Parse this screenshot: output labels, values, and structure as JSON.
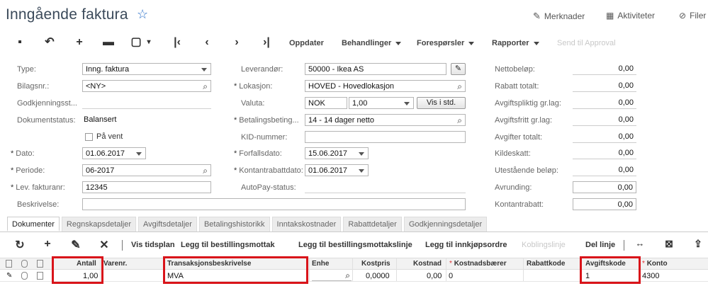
{
  "header": {
    "title": "Inngående faktura",
    "links": {
      "notes": "Merknader",
      "activities": "Aktiviteter",
      "files": "Filer"
    }
  },
  "toolbar": {
    "menus": {
      "refresh": "Oppdater",
      "actions": "Behandlinger",
      "inquiries": "Forespørsler",
      "reports": "Rapporter",
      "send_approval": "Send til Approval"
    }
  },
  "form": {
    "type": {
      "label": "Type:",
      "value": "Inng. faktura"
    },
    "ref_nbr": {
      "label": "Bilagsnr.:",
      "value": "<NY>"
    },
    "approval_status": {
      "label": "Godkjenningsst...",
      "value": ""
    },
    "doc_status": {
      "label": "Dokumentstatus:",
      "value": "Balansert"
    },
    "on_hold": {
      "label": "På vent"
    },
    "date": {
      "label": "Dato:",
      "value": "01.06.2017"
    },
    "period": {
      "label": "Periode:",
      "value": "06-2017"
    },
    "vendor_ref": {
      "label": "Lev. fakturanr:",
      "value": "12345"
    },
    "description": {
      "label": "Beskrivelse:",
      "value": ""
    },
    "vendor": {
      "label": "Leverandør:",
      "value": "50000 - Ikea AS"
    },
    "location": {
      "label": "Lokasjon:",
      "value": "HOVED - Hovedlokasjon"
    },
    "currency": {
      "label": "Valuta:",
      "code": "NOK",
      "rate": "1,00",
      "button": "Vis i std."
    },
    "terms": {
      "label": "Betalingsbeting...",
      "value": "14 - 14 dager netto"
    },
    "kid": {
      "label": "KID-nummer:",
      "value": ""
    },
    "due_date": {
      "label": "Forfallsdato:",
      "value": "15.06.2017"
    },
    "discount_date": {
      "label": "Kontantrabattdato:",
      "value": "01.06.2017"
    },
    "autopay": {
      "label": "AutoPay-status:",
      "value": ""
    }
  },
  "totals": [
    {
      "label": "Nettobeløp:",
      "value": "0,00"
    },
    {
      "label": "Rabatt totalt:",
      "value": "0,00"
    },
    {
      "label": "Avgiftspliktig gr.lag:",
      "value": "0,00"
    },
    {
      "label": "Avgiftsfritt gr.lag:",
      "value": "0,00"
    },
    {
      "label": "Avgifter totalt:",
      "value": "0,00"
    },
    {
      "label": "Kildeskatt:",
      "value": "0,00"
    },
    {
      "label": "Utestående beløp:",
      "value": "0,00"
    },
    {
      "label": "Avrunding:",
      "value": "0,00"
    },
    {
      "label": "Kontantrabatt:",
      "value": "0,00"
    }
  ],
  "tabs": [
    "Dokumenter",
    "Regnskapsdetaljer",
    "Avgiftsdetaljer",
    "Betalingshistorikk",
    "Inntakskostnader",
    "Rabattdetaljer",
    "Godkjenningsdetaljer"
  ],
  "grid_toolbar": {
    "schedule": "Vis tidsplan",
    "add_receipt": "Legg til bestillingsmottak",
    "add_receipt_line": "Legg til bestillingsmottakslinje",
    "add_po": "Legg til innkjøpsordre",
    "link_line": "Koblingslinje",
    "split_line": "Del linje"
  },
  "grid": {
    "headers": {
      "qty": "Antall",
      "item": "Varenr.",
      "descr": "Transaksjonsbeskrivelse",
      "uom": "Enhe",
      "unit_cost": "Kostpris",
      "cost": "Kostnad",
      "costcode": "Kostnadsbærer",
      "discount_code": "Rabattkode",
      "tax_code": "Avgiftskode",
      "account": "Konto"
    },
    "row": {
      "qty": "1,00",
      "item": "",
      "descr": "MVA",
      "uom": "",
      "unit_cost": "0,0000",
      "cost": "0,00",
      "costcode": "0",
      "discount_code": "",
      "tax_code": "1",
      "account": "4300"
    }
  },
  "colors": {
    "highlight": "#d9141a",
    "accent": "#2a6fc9"
  }
}
